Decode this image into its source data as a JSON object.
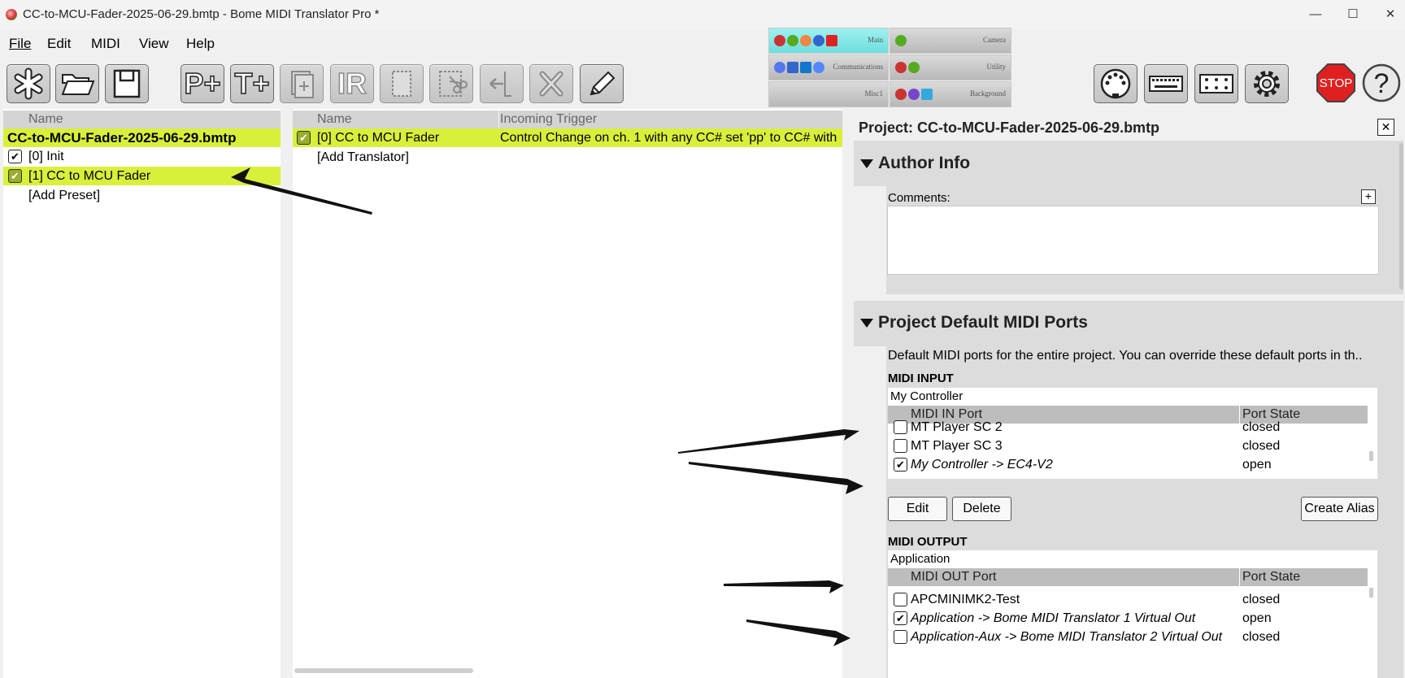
{
  "window": {
    "title": "CC-to-MCU-Fader-2025-06-29.bmtp - Bome MIDI Translator Pro *",
    "minimize": "—",
    "maximize": "☐",
    "close": "✕"
  },
  "menu": [
    "File",
    "Edit",
    "MIDI",
    "View",
    "Help"
  ],
  "toolbar": {
    "buttons": [
      {
        "name": "new-project-button",
        "icon": "asterisk-icon",
        "enabled": true
      },
      {
        "name": "open-project-button",
        "icon": "folder-open-icon",
        "enabled": true
      },
      {
        "name": "save-project-button",
        "icon": "save-icon",
        "enabled": true
      },
      {
        "name": "add-preset-button",
        "text": "P+",
        "enabled": true
      },
      {
        "name": "add-translator-button",
        "text": "T+",
        "enabled": true
      },
      {
        "name": "duplicate-button",
        "icon": "duplicate-icon",
        "enabled": false
      },
      {
        "name": "ir-button",
        "text": "IR",
        "enabled": false
      },
      {
        "name": "copy-button",
        "icon": "copy-icon",
        "enabled": false
      },
      {
        "name": "cut-button",
        "icon": "scissors-icon",
        "enabled": false
      },
      {
        "name": "paste-button",
        "icon": "paste-icon",
        "enabled": false
      },
      {
        "name": "delete-button",
        "icon": "x-icon",
        "enabled": false
      },
      {
        "name": "edit-button",
        "icon": "pencil-icon",
        "enabled": true
      }
    ],
    "right_buttons": [
      "midi-port-icon",
      "keyboard-icon",
      "dots-icon",
      "gear-icon",
      "stop-icon",
      "help-icon"
    ],
    "stop_label": "STOP",
    "help_label": "?"
  },
  "project_tabs": [
    {
      "label": "Main",
      "active": true
    },
    {
      "label": "Camera",
      "active": false
    },
    {
      "label": "Communications",
      "active": false
    },
    {
      "label": "Utility",
      "active": false
    },
    {
      "label": "Misc1",
      "active": false
    },
    {
      "label": "Background",
      "active": false
    }
  ],
  "presets": {
    "header": "Name",
    "project_name": "CC-to-MCU-Fader-2025-06-29.bmtp",
    "items": [
      {
        "label": "[0] Init",
        "checked": true,
        "selected": false
      },
      {
        "label": "[1] CC to MCU Fader",
        "checked": true,
        "selected": true
      }
    ],
    "add": "[Add Preset]"
  },
  "translators": {
    "headers": [
      "Name",
      "Incoming Trigger"
    ],
    "items": [
      {
        "name": "[0] CC to MCU Fader",
        "trigger": "Control Change on ch. 1 with any CC# set 'pp' to CC# with",
        "checked": true
      }
    ],
    "add": "[Add Translator]"
  },
  "properties": {
    "title": "Project: CC-to-MCU-Fader-2025-06-29.bmtp",
    "close": "✕",
    "author": {
      "heading": "Author Info",
      "comments_label": "Comments:",
      "add": "+"
    },
    "ports": {
      "heading": "Project Default MIDI Ports",
      "description": "Default MIDI ports for the entire project. You can override these default ports in th..",
      "input": {
        "label": "MIDI INPUT",
        "alias": "My Controller",
        "col_port": "MIDI IN Port",
        "col_state": "Port State",
        "rows": [
          {
            "port": "MT Player SC 2",
            "state": "closed",
            "checked": false,
            "italic": false
          },
          {
            "port": "MT Player SC 3",
            "state": "closed",
            "checked": false,
            "italic": false
          },
          {
            "port": "My Controller -> EC4-V2",
            "state": "open",
            "checked": true,
            "italic": true
          }
        ]
      },
      "buttons": {
        "edit": "Edit",
        "delete": "Delete",
        "create_alias": "Create Alias"
      },
      "output": {
        "label": "MIDI OUTPUT",
        "alias": "Application",
        "col_port": "MIDI OUT Port",
        "col_state": "Port State",
        "rows": [
          {
            "port": "APCMINIMK2-Test",
            "state": "closed",
            "checked": false,
            "italic": false
          },
          {
            "port": "Application -> Bome MIDI Translator 1 Virtual Out",
            "state": "open",
            "checked": true,
            "italic": true
          },
          {
            "port": "Application-Aux -> Bome MIDI Translator 2 Virtual Out",
            "state": "closed",
            "checked": false,
            "italic": true
          }
        ]
      }
    }
  }
}
